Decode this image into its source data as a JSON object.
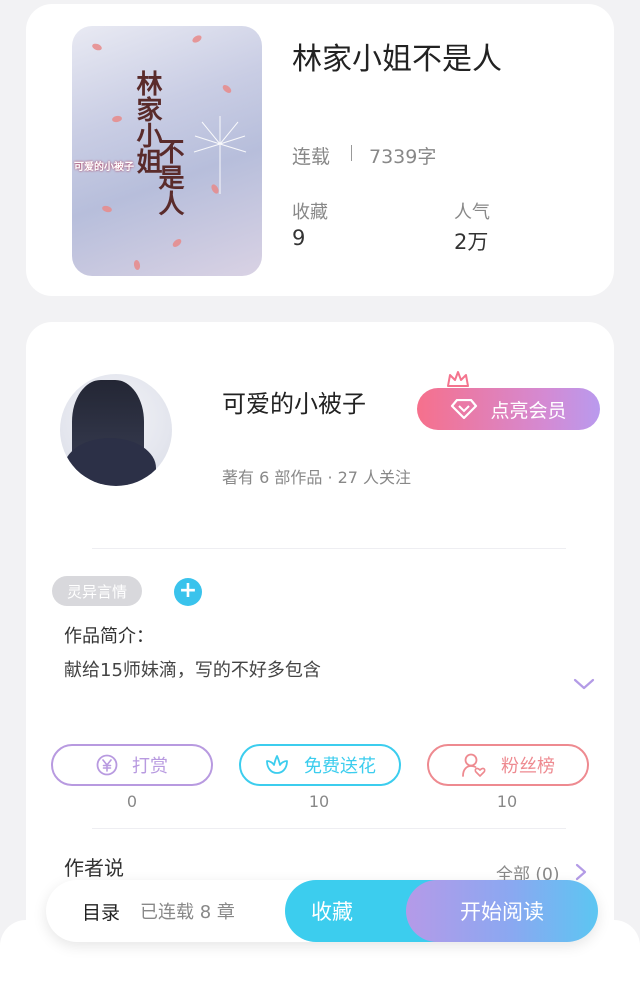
{
  "book": {
    "title": "林家小姐不是人",
    "status": "连载",
    "word_count": "7339字",
    "stats": [
      {
        "label": "收藏",
        "value": "9"
      },
      {
        "label": "人气",
        "value": "2万"
      }
    ],
    "cover": {
      "title_line1": "林家小姐",
      "title_line2": "不是人",
      "author": "可爱的小被子"
    }
  },
  "author": {
    "name": "可爱的小被子",
    "meta": "著有 6 部作品 · 27 人关注",
    "vip_button": "点亮会员"
  },
  "intro": {
    "tag": "灵异言情",
    "add": "+",
    "label": "作品简介：",
    "text": "献给15师妹滴，写的不好多包含"
  },
  "actions": [
    {
      "label": "打赏",
      "count": "0",
      "color": "#b89ae0",
      "icon": "yen-coin-icon"
    },
    {
      "label": "免费送花",
      "count": "10",
      "color": "#3ccdee",
      "icon": "flower-icon"
    },
    {
      "label": "粉丝榜",
      "count": "10",
      "color": "#ee8a90",
      "icon": "fan-user-icon"
    }
  ],
  "author_says": {
    "label": "作者说",
    "all": "全部 (0)"
  },
  "bottom_bar": {
    "toc_label": "目录",
    "toc_status": "已连载 8 章",
    "favorite": "收藏",
    "start_reading": "开始阅读"
  }
}
